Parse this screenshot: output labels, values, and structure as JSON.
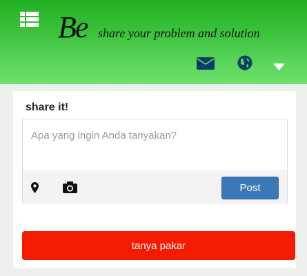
{
  "header": {
    "brand_letter": "Be",
    "tagline": "share your problem and solution",
    "icons": [
      "menu-icon",
      "mail-icon",
      "globe-icon",
      "caret-down-icon"
    ],
    "colors": {
      "header_green": "#2cb52c"
    }
  },
  "composer": {
    "title": "share it!",
    "placeholder": "Apa yang ingin Anda tanyakan?",
    "icons": [
      "map-pin-icon",
      "camera-icon"
    ],
    "post_label": "Post",
    "colors": {
      "post_button": "#3a78b8"
    }
  },
  "ask_expert": {
    "label": "tanya pakar",
    "color": "#f51b00"
  }
}
